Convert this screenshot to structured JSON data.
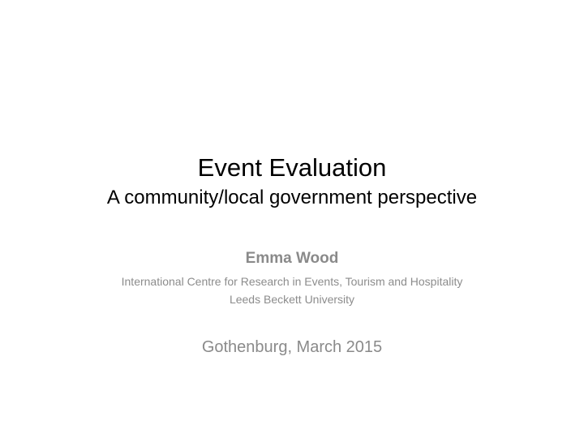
{
  "slide": {
    "title": "Event Evaluation",
    "subtitle": "A community/local government perspective",
    "author": "Emma Wood",
    "affiliation": "International Centre for Research in Events, Tourism and Hospitality",
    "university": "Leeds Beckett University",
    "location_date": "Gothenburg, March 2015"
  },
  "colors": {
    "title_text": "#000000",
    "subtitle_text": "#8a8a8a",
    "background": "#ffffff"
  }
}
